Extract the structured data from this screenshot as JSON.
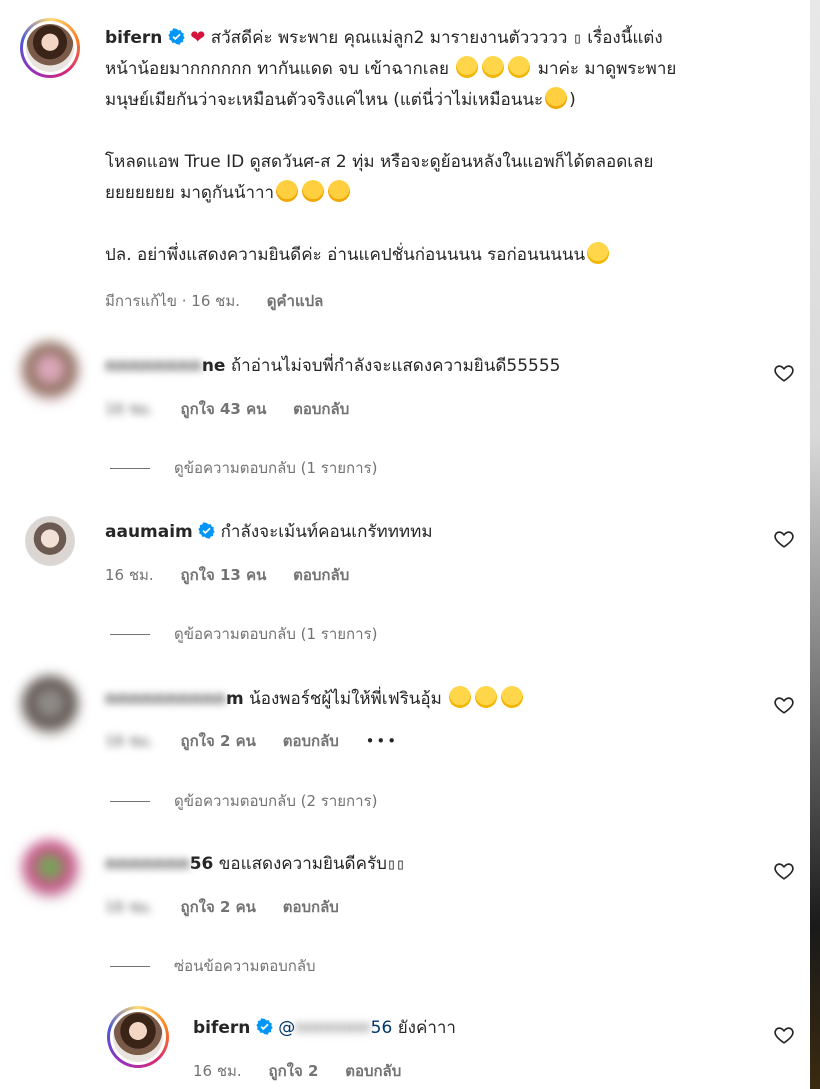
{
  "caption": {
    "username": "bifern",
    "heart_glyph": "❤",
    "line1": "สวัสดีค่ะ พระพาย คุณแม่ลูก2 มารายงานตัววววว",
    "box1": "▯",
    "line1b": "เรื่องนี้แต่ง",
    "line2": "หน้าน้อยมากกกกกก ทากันแดด จบ เข้าฉากเลย",
    "line2b": "มาค่ะ มาดูพระพาย",
    "line3": "มนุษย์เมียกันว่าจะเหมือนตัวจริงแค่ไหน (แต่นี่ว่าไม่เหมือนนะ",
    "line3b": ")",
    "para2_line1": "โหลดแอพ True ID ดูสดวันศ-ส 2 ทุ่ม หรือจะดูย้อนหลังในแอพก็ได้ตลอดเลย",
    "para2_line2": "ยยยยยยย มาดูกันน้าาา",
    "para3": "ปล. อย่าพึ่งแสดงความยินดีค่ะ อ่านแคปชั่นก่อนนนน รอก่อนนนนน",
    "meta_edited": "มีการแก้ไข · 16 ชม.",
    "meta_translate": "ดูคำแปล"
  },
  "comments": [
    {
      "user_visible": "ne",
      "user_hidden": "nnnnnnnn",
      "text": "ถ้าอ่านไม่จบพี่กำลังจะแสดงความยินดี55555",
      "time": "16 ชม.",
      "likes": "ถูกใจ 43 คน",
      "reply": "ตอบกลับ",
      "view_replies": "ดูข้อความตอบกลับ (1 รายการ)"
    },
    {
      "user_visible": "aaumaim",
      "text": "กำลังจะเม้นท์คอนเกรัททททม",
      "time": "16 ชม.",
      "likes": "ถูกใจ 13 คน",
      "reply": "ตอบกลับ",
      "view_replies": "ดูข้อความตอบกลับ (1 รายการ)"
    },
    {
      "user_visible": "m",
      "user_hidden": "nnnnnnnnnn",
      "text": "น้องพอร์ชผู้ไม่ให้พี่เฟรินอุ้ม",
      "time": "16 ชม.",
      "likes": "ถูกใจ 2 คน",
      "reply": "ตอบกลับ",
      "more": "•••",
      "view_replies": "ดูข้อความตอบกลับ (2 รายการ)"
    },
    {
      "user_visible": "56",
      "user_hidden": "nnnnnnn",
      "text": "ขอแสดงความยินดีครับ",
      "box": "▯▯",
      "time": "16 ชม.",
      "likes": "ถูกใจ 2 คน",
      "reply": "ตอบกลับ",
      "view_replies": "ซ่อนข้อความตอบกลับ"
    }
  ],
  "reply": {
    "username": "bifern",
    "mention_visible": "56",
    "mention_prefix": "@",
    "mention_hidden": "nnnnnnn",
    "text": "ยังค่าาา",
    "time": "16 ชม.",
    "likes_visible": "ถูกใจ 2",
    "reply": "ตอบกลับ"
  },
  "colors": {
    "verified": "#0095f6",
    "meta": "#737373",
    "text": "#262626"
  },
  "icons": {
    "verified": "verified-badge-icon",
    "heart": "heart-outline-icon",
    "emoji_laugh": "grinning-squinting-face-emoji",
    "emoji_kiss": "face-blowing-kiss-emoji",
    "emoji_tongue": "face-with-tongue-emoji"
  }
}
